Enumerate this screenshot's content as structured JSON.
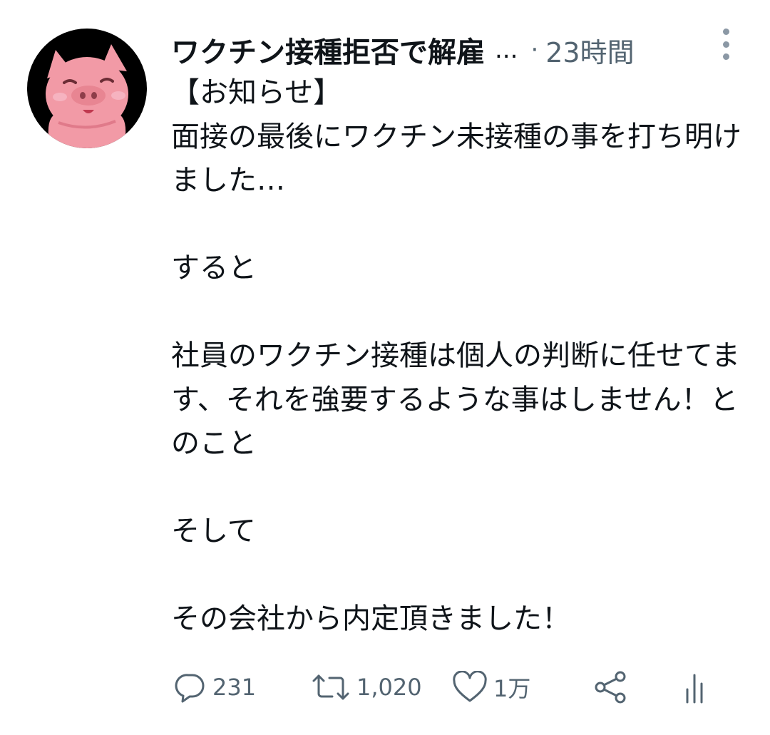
{
  "tweet": {
    "display_name": "ワクチン接種拒否で解雇",
    "truncation": "...",
    "separator": "·",
    "timestamp": "23時間",
    "body": "【お知らせ】\n面接の最後にワクチン未接種の事を打ち明けました…\n\nすると\n\n社員のワクチン接種は個人の判断に任せてます、それを強要するような事はしません！とのこと\n\nそして\n\nその会社から内定頂きました！"
  },
  "actions": {
    "reply": {
      "icon": "reply-bubble-icon",
      "count": "231"
    },
    "retweet": {
      "icon": "retweet-icon",
      "count": "1,020"
    },
    "like": {
      "icon": "heart-icon",
      "count": "1万"
    },
    "share": {
      "icon": "share-icon"
    },
    "views": {
      "icon": "analytics-bars-icon"
    }
  },
  "colors": {
    "text_primary": "#0f1419",
    "text_secondary": "#536471",
    "avatar_bg": "#000000",
    "pig_pink": "#f29aa6"
  }
}
